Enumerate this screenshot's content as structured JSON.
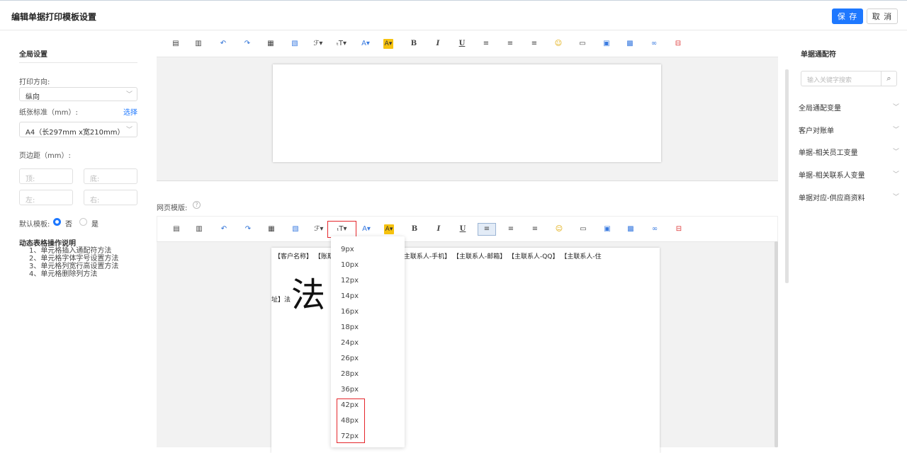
{
  "header": {
    "title": "编辑单据打印模板设置",
    "save": "保 存",
    "cancel": "取 消"
  },
  "left": {
    "section_title": "全局设置",
    "orientation_label": "打印方向:",
    "orientation_value": "纵向",
    "paper_label": "纸张标准（mm）:",
    "paper_select_link": "选择",
    "paper_value": "A4（长297mm x宽210mm）",
    "margin_label": "页边距（mm）:",
    "margin_top": "顶:",
    "margin_bottom": "底:",
    "margin_left": "左:",
    "margin_right": "右:",
    "default_label": "默认模板:",
    "default_no": "否",
    "default_yes": "是",
    "help_title": "动态表格操作说明",
    "help_items": [
      "1、单元格插入通配符方法",
      "2、单元格字体字号设置方法",
      "3、单元格列宽行高设置方法",
      "4、单元格删除列方法"
    ]
  },
  "center": {
    "web_template_label": "网页模版:",
    "help_icon": "?",
    "template_line": "【客户名称】 【账期】 【主联系人-姓名】 【主联系人-手机】 【主联系人-邮箱】 【主联系人-QQ】 【主联系人-住",
    "big_char": "法",
    "small_text": "址】法",
    "toolbar_icons": [
      "paste-icon",
      "paste-text-icon",
      "undo-icon",
      "redo-icon",
      "paste-word-icon",
      "paste-format-icon",
      "font-family-icon",
      "font-size-icon",
      "font-color-icon",
      "highlight-icon",
      "bold-icon",
      "italic-icon",
      "underline-icon",
      "align-left-icon",
      "align-center-icon",
      "align-right-icon",
      "emoji-icon",
      "insert-line-icon",
      "table-icon",
      "image-icon",
      "link-icon",
      "page-break-icon"
    ],
    "toolbar_glyphs": {
      "ff": "ℱ▾",
      "fs": "ₜT▾",
      "fc": "A▾",
      "hl": "A▾",
      "b": "B",
      "i": "I",
      "u": "U"
    }
  },
  "font_size_dropdown": [
    "9px",
    "10px",
    "12px",
    "14px",
    "16px",
    "18px",
    "24px",
    "26px",
    "28px",
    "36px",
    "42px",
    "48px",
    "72px"
  ],
  "right": {
    "title": "单据通配符",
    "search_placeholder": "输入关键字搜索",
    "items": [
      "全局通配变量",
      "客户对账单",
      "单据-相关员工变量",
      "单据-相关联系人变量",
      "单据对应-供应商资料"
    ]
  },
  "colors": {
    "primary": "#1e78ff",
    "highlight_red": "#e5262b",
    "highlight_yellow": "#f6c20e"
  }
}
